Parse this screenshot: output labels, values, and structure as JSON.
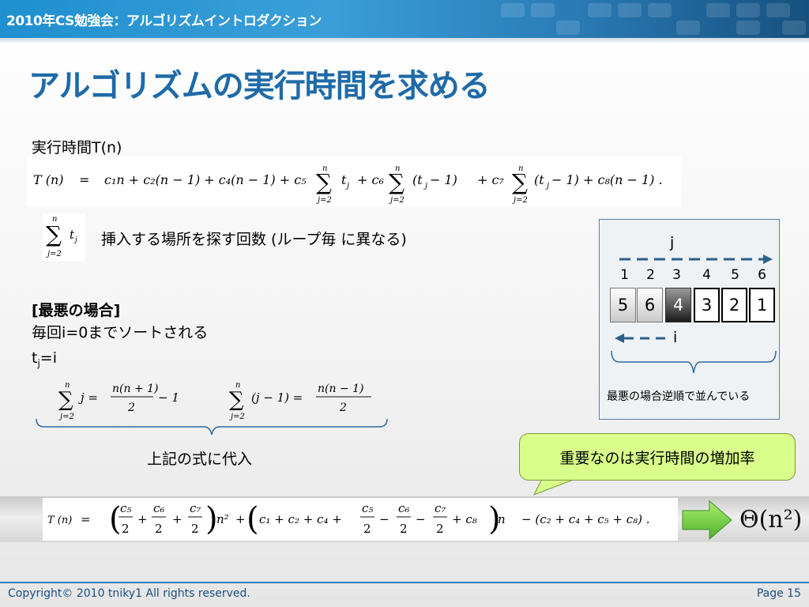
{
  "header": {
    "title": "2010年CS勉強会：アルゴリズムイントロダクション"
  },
  "slide": {
    "title": "アルゴリズムの実行時間を求める"
  },
  "body": {
    "runtime_label": "実行時間T(n)",
    "sum_desc": "挿入する場所を探す回数 (ループ毎 に異なる)",
    "worst_case_heading": "[最悪の場合]",
    "worst_case_line1": "毎回i=0までソートされる",
    "tj_t": "t",
    "tj_sub": "j",
    "tj_rest": "=i",
    "substitute_label": "上記の式に代入"
  },
  "equation1": {
    "lhs": "T (n)",
    "eq": "=",
    "part1": "c₁n + c₂(n − 1) + c₄(n − 1) + c₅",
    "part2": "t",
    "part3": "+ c₆",
    "part4": "(t",
    "part5": " − 1)",
    "part6": "+ c₇",
    "part7": "(t",
    "part8": " − 1) + c₈(n − 1) .",
    "sum_top": "n",
    "sum_bottom": "j=2",
    "sub_j": "j"
  },
  "sum_inline": {
    "top": "n",
    "bottom": "j=2",
    "term": "t",
    "sub": "j"
  },
  "formulas": {
    "f1_top": "n",
    "f1_bottom": "j=2",
    "f1_body": "j =",
    "f1_num": "n(n + 1)",
    "f1_den": "2",
    "f1_tail": "− 1",
    "f2_top": "n",
    "f2_bottom": "j=2",
    "f2_body": "(j − 1) =",
    "f2_num": "n(n − 1)",
    "f2_den": "2"
  },
  "final_equation": {
    "lhs": "T (n)",
    "eq": "=",
    "c5": "c₅",
    "c6": "c₆",
    "c7": "c₇",
    "two": "2",
    "n2": "n²",
    "plus": "+",
    "mid": "c₁ + c₂ + c₄ +",
    "minus": "−",
    "c8n": "+ c₈",
    "n": "n",
    "tail": "− (c₂ + c₄ + c₅ + c₈) ."
  },
  "theta": "Θ(n²)",
  "diagram": {
    "j_label": "j",
    "i_label": "i",
    "indices": [
      "1",
      "2",
      "3",
      "4",
      "5",
      "6"
    ],
    "cells": [
      "5",
      "6",
      "4",
      "3",
      "2",
      "1"
    ],
    "caption": "最悪の場合逆順で並んでいる",
    "arrow_color": "#2e5f8a"
  },
  "callout": {
    "text": "重要なのは実行時間の増加率"
  },
  "footer": {
    "copyright": "Copyright© 2010 tniky1  All rights reserved.",
    "page": "Page 15"
  },
  "colors": {
    "title": "#1f6aa8",
    "header": "#2a8fd0",
    "callout": "#d9ff8a",
    "arrow": "#6ecf3a"
  }
}
